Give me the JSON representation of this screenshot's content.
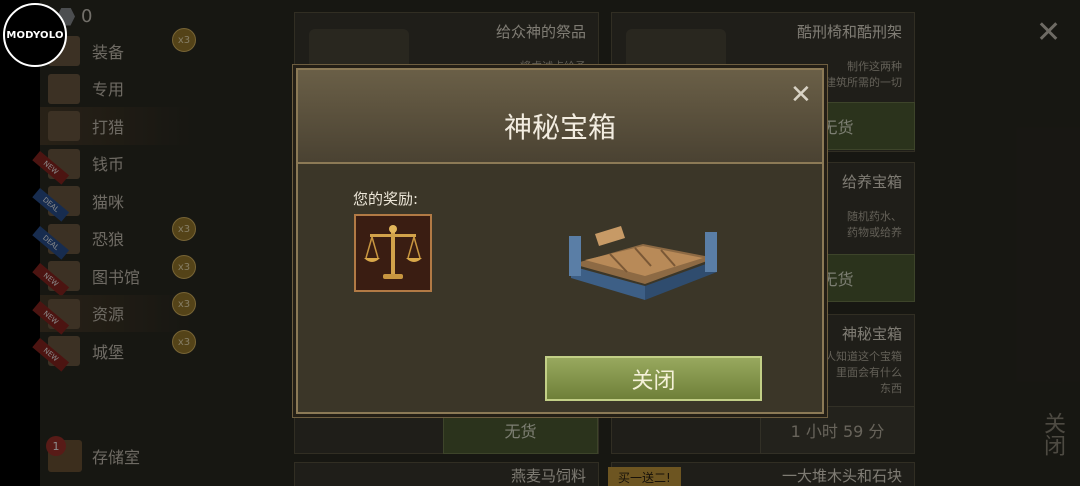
{
  "watermark": {
    "label": "MODYOLO"
  },
  "currency": {
    "amount": "0",
    "icon": "gem-icon"
  },
  "sidebar": {
    "items": [
      {
        "label": "装备",
        "badge": "x3",
        "tag": "",
        "active": false
      },
      {
        "label": "专用",
        "badge": "",
        "tag": "",
        "active": false
      },
      {
        "label": "打猎",
        "badge": "",
        "tag": "",
        "active": true
      },
      {
        "label": "钱币",
        "badge": "",
        "tag": "NEW",
        "active": false
      },
      {
        "label": "猫咪",
        "badge": "",
        "tag": "DEAL",
        "active": false
      },
      {
        "label": "恐狼",
        "badge": "x3",
        "tag": "DEAL",
        "active": false
      },
      {
        "label": "图书馆",
        "badge": "x3",
        "tag": "NEW",
        "active": false
      },
      {
        "label": "资源",
        "badge": "x3",
        "tag": "NEW",
        "active": true
      },
      {
        "label": "城堡",
        "badge": "x3",
        "tag": "NEW",
        "active": false
      }
    ],
    "storage": {
      "label": "存储室",
      "count": "1"
    }
  },
  "shop": {
    "cards": [
      {
        "title": "给众神的祭品",
        "desc": "将虔诚点给予",
        "button": ""
      },
      {
        "title": "酷刑椅和酷刑架",
        "desc": "制作这两种\n建筑所需的一切",
        "button": "无货"
      },
      {
        "title": "给养宝箱",
        "desc": "随机药水、\n药物或给养",
        "button": "无货"
      },
      {
        "title": "神秘宝箱",
        "desc": "人知道这个宝箱\n里面会有什么\n东西",
        "button": "1 小时 59 分"
      },
      {
        "title": "",
        "desc": "",
        "button": "无货"
      },
      {
        "title": "燕麦马饲料",
        "desc": "",
        "button": ""
      },
      {
        "title": "一大堆木头和石块",
        "desc": "",
        "button": ""
      }
    ],
    "promo": "买一送二!",
    "close_label": "关闭"
  },
  "modal": {
    "title": "神秘宝箱",
    "reward_label": "您的奖励:",
    "reward_icon": "scales-icon",
    "reward_item": "chest-frame-icon",
    "close_button": "关闭"
  },
  "colors": {
    "accent_green": "#7f9044",
    "gold_border": "#8c7a56",
    "new_tag": "#8a2620",
    "deal_tag": "#2a5190"
  }
}
